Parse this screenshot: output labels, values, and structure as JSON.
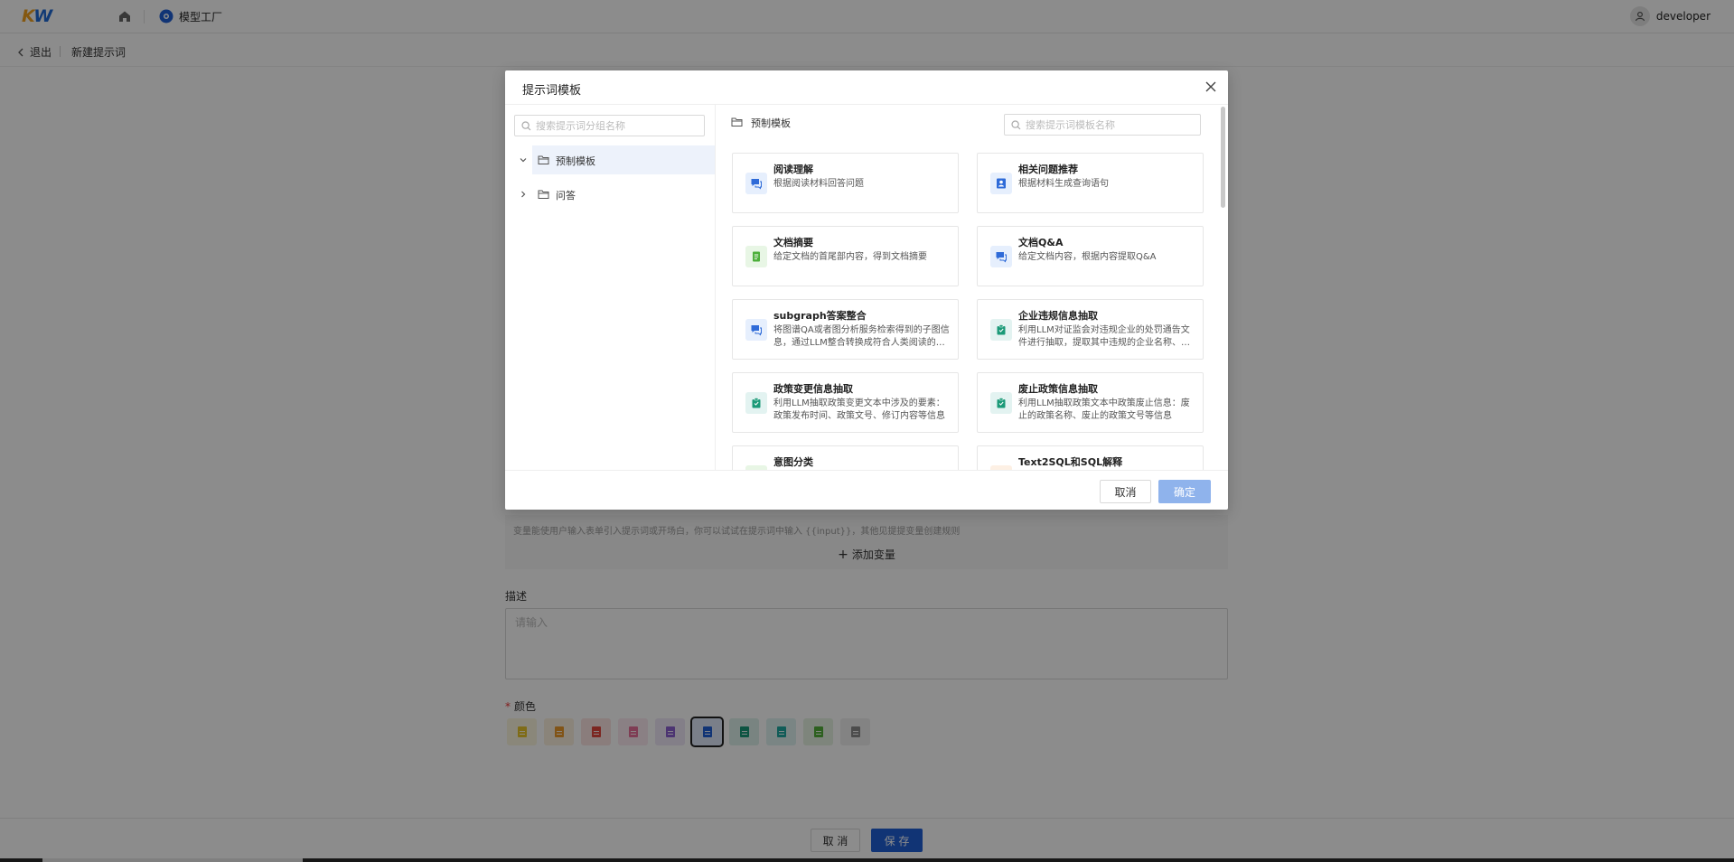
{
  "app": {
    "logo_k": "K",
    "logo_w": "W",
    "nav_current": "模型工厂",
    "user_name": "developer"
  },
  "subbar": {
    "back_label": "退出",
    "breadcrumb": "新建提示词"
  },
  "form": {
    "variables_hint": "变量能使用户输入表单引入提示词或开场白，你可以试试在提示词中输入 {{input}}，其他见提提变量创建规则",
    "add_variable_label": "添加变量",
    "description_label": "描述",
    "description_placeholder": "请输入",
    "color_label": "颜色",
    "colors": [
      "#e8c52a",
      "#ec9a2a",
      "#e2453c",
      "#e8709a",
      "#8a5fd0",
      "#1f5fd6",
      "#1b9a78",
      "#20a8a0",
      "#52b03a",
      "#8a8a8a"
    ],
    "selected_color_index": 5
  },
  "footer": {
    "cancel_label": "取 消",
    "save_label": "保 存"
  },
  "modal": {
    "title": "提示词模板",
    "group_search_placeholder": "搜索提示词分组名称",
    "template_search_placeholder": "搜索提示词模板名称",
    "groups": [
      {
        "label": "预制模板",
        "expanded": true,
        "active": true
      },
      {
        "label": "问答",
        "expanded": false,
        "active": false
      }
    ],
    "current_group": "预制模板",
    "templates": [
      {
        "title": "阅读理解",
        "desc": "根据阅读材料回答问题",
        "icon": "chat-icon",
        "color": "#2f6bd8"
      },
      {
        "title": "相关问题推荐",
        "desc": "根据材料生成查询语句",
        "icon": "contact-icon",
        "color": "#2f6bd8"
      },
      {
        "title": "文档摘要",
        "desc": "给定文档的首尾部内容，得到文档摘要",
        "icon": "document-icon",
        "color": "#4caf3a"
      },
      {
        "title": "文档Q&A",
        "desc": "给定文档内容，根据内容提取Q&A",
        "icon": "chat-icon",
        "color": "#2f6bd8"
      },
      {
        "title": "subgraph答案整合",
        "desc": "将图谱QA或者图分析服务检索得到的子图信息，通过LLM整合转换成符合人类阅读的答案",
        "icon": "chat-icon",
        "color": "#2f6bd8"
      },
      {
        "title": "企业违规信息抽取",
        "desc": "利用LLM对证监会对违规企业的处罚通告文件进行抽取，提取其中违规的企业名称、违规行为等信息",
        "icon": "clipboard-icon",
        "color": "#1b9a78"
      },
      {
        "title": "政策变更信息抽取",
        "desc": "利用LLM抽取政策变更文本中涉及的要素：政策发布时间、政策文号、修订内容等信息",
        "icon": "clipboard-icon",
        "color": "#1b9a78"
      },
      {
        "title": "废止政策信息抽取",
        "desc": "利用LLM抽取政策文本中政策废止信息：废止的政策名称、废止的政策文号等信息",
        "icon": "clipboard-icon",
        "color": "#1b9a78"
      },
      {
        "title": "意图分类",
        "desc": "",
        "icon": "document-icon",
        "color": "#4caf3a"
      },
      {
        "title": "Text2SQL和SQL解释",
        "desc": "",
        "icon": "code-icon",
        "color": "#ec9a2a"
      }
    ],
    "cancel_label": "取消",
    "ok_label": "确定"
  }
}
